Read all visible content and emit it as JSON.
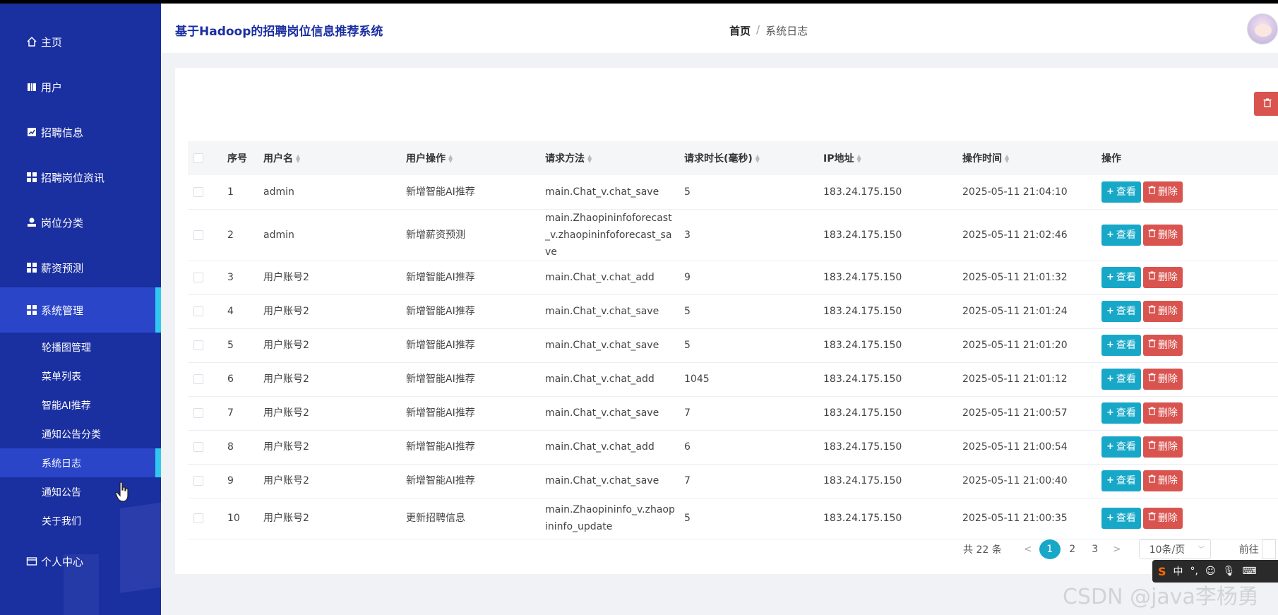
{
  "app": {
    "title": "基于Hadoop的招聘岗位信息推荐系统"
  },
  "breadcrumb": {
    "home": "首页",
    "sep": "/",
    "current": "系统日志"
  },
  "sidebar": {
    "items": [
      {
        "label": "主页",
        "icon": "home-icon"
      },
      {
        "label": "用户",
        "icon": "book-icon"
      },
      {
        "label": "招聘信息",
        "icon": "chart-icon"
      },
      {
        "label": "招聘岗位资讯",
        "icon": "grid-icon"
      },
      {
        "label": "岗位分类",
        "icon": "user-icon"
      },
      {
        "label": "薪资预测",
        "icon": "grid-icon"
      },
      {
        "label": "系统管理",
        "icon": "grid-icon"
      },
      {
        "label": "个人中心",
        "icon": "id-card-icon"
      }
    ],
    "sub_items": [
      {
        "label": "轮播图管理"
      },
      {
        "label": "菜单列表"
      },
      {
        "label": "智能AI推荐"
      },
      {
        "label": "通知公告分类"
      },
      {
        "label": "系统日志"
      },
      {
        "label": "通知公告"
      },
      {
        "label": "关于我们"
      }
    ]
  },
  "table": {
    "headers": [
      "序号",
      "用户名",
      "用户操作",
      "请求方法",
      "请求时长(毫秒)",
      "IP地址",
      "操作时间",
      "操作"
    ],
    "view_label": "查看",
    "delete_label": "删除",
    "rows": [
      {
        "no": "1",
        "user": "admin",
        "op": "新增智能AI推荐",
        "method": "main.Chat_v.chat_save",
        "duration": "5",
        "ip": "183.24.175.150",
        "time": "2025-05-11 21:04:10"
      },
      {
        "no": "2",
        "user": "admin",
        "op": "新增薪资预测",
        "method": "main.Zhaopininfoforecast_v.zhaopininfoforecast_save",
        "duration": "3",
        "ip": "183.24.175.150",
        "time": "2025-05-11 21:02:46"
      },
      {
        "no": "3",
        "user": "用户账号2",
        "op": "新增智能AI推荐",
        "method": "main.Chat_v.chat_add",
        "duration": "9",
        "ip": "183.24.175.150",
        "time": "2025-05-11 21:01:32"
      },
      {
        "no": "4",
        "user": "用户账号2",
        "op": "新增智能AI推荐",
        "method": "main.Chat_v.chat_save",
        "duration": "5",
        "ip": "183.24.175.150",
        "time": "2025-05-11 21:01:24"
      },
      {
        "no": "5",
        "user": "用户账号2",
        "op": "新增智能AI推荐",
        "method": "main.Chat_v.chat_save",
        "duration": "5",
        "ip": "183.24.175.150",
        "time": "2025-05-11 21:01:20"
      },
      {
        "no": "6",
        "user": "用户账号2",
        "op": "新增智能AI推荐",
        "method": "main.Chat_v.chat_add",
        "duration": "1045",
        "ip": "183.24.175.150",
        "time": "2025-05-11 21:01:12"
      },
      {
        "no": "7",
        "user": "用户账号2",
        "op": "新增智能AI推荐",
        "method": "main.Chat_v.chat_save",
        "duration": "7",
        "ip": "183.24.175.150",
        "time": "2025-05-11 21:00:57"
      },
      {
        "no": "8",
        "user": "用户账号2",
        "op": "新增智能AI推荐",
        "method": "main.Chat_v.chat_add",
        "duration": "6",
        "ip": "183.24.175.150",
        "time": "2025-05-11 21:00:54"
      },
      {
        "no": "9",
        "user": "用户账号2",
        "op": "新增智能AI推荐",
        "method": "main.Chat_v.chat_save",
        "duration": "7",
        "ip": "183.24.175.150",
        "time": "2025-05-11 21:00:40"
      },
      {
        "no": "10",
        "user": "用户账号2",
        "op": "更新招聘信息",
        "method": "main.Zhaopininfo_v.zhaopininfo_update",
        "duration": "5",
        "ip": "183.24.175.150",
        "time": "2025-05-11 21:00:35"
      }
    ]
  },
  "pagination": {
    "total": "共 22 条",
    "prev": "<",
    "next": ">",
    "pages": [
      "1",
      "2",
      "3"
    ],
    "current": "1",
    "page_size": "10条/页",
    "goto_label": "前往"
  },
  "ime": {
    "logo": "S",
    "lang": "中",
    "punct": "°,"
  },
  "watermark": "CSDN @java李杨勇",
  "colors": {
    "sidebar": "#1a2fa0",
    "accent": "#17a8c8",
    "danger": "#d9534f",
    "active_bar": "#31c8f0"
  }
}
